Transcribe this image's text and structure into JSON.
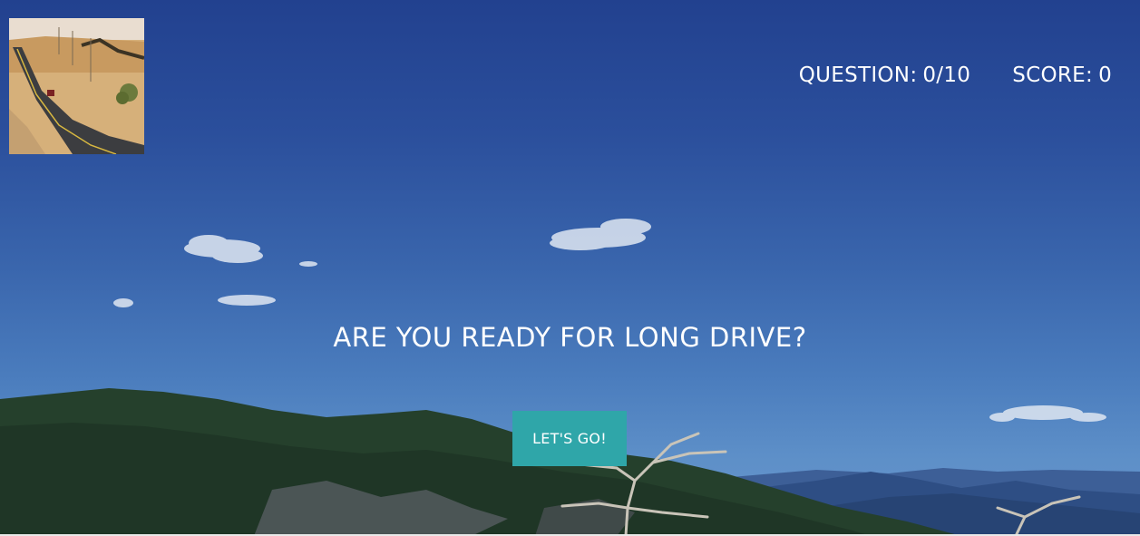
{
  "hud": {
    "question_label": "QUESTION:",
    "question_value": "0/10",
    "score_label": "SCORE:",
    "score_value": "0"
  },
  "main": {
    "prompt": "ARE YOU READY FOR LONG DRIVE?",
    "start_button_label": "LET'S GO!"
  },
  "colors": {
    "button": "#2fa6a9",
    "text": "#ffffff",
    "sky_top": "#22418f",
    "sky_bottom": "#6a98cc"
  },
  "icons": {
    "logo": "desert-road-logo"
  }
}
